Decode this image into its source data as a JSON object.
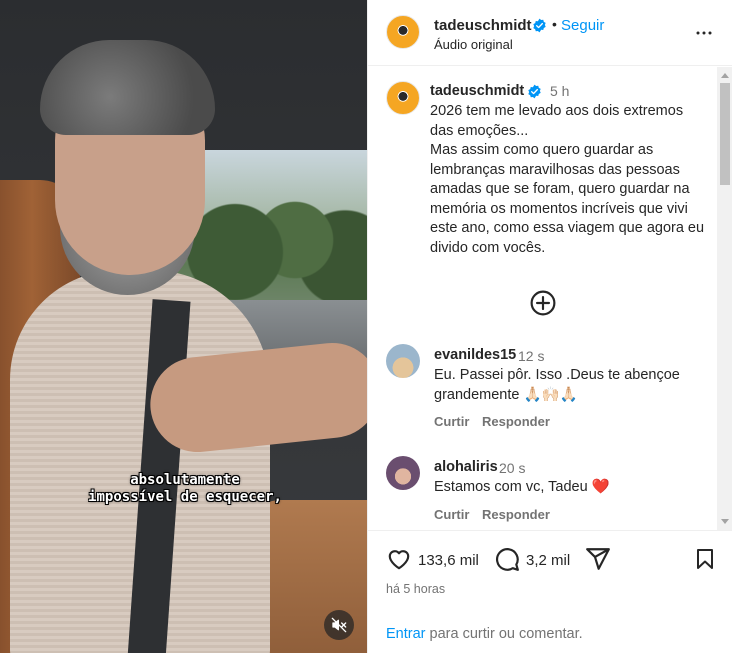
{
  "video": {
    "subtitle_line1": "absolutamente",
    "subtitle_line2": "impossível de esquecer,",
    "mute_icon": "speaker-muted-icon"
  },
  "header": {
    "username": "tadeuschmidt",
    "separator": "•",
    "follow_label": "Seguir",
    "audio_label": "Áudio original",
    "more_icon": "more-horizontal-icon"
  },
  "caption": {
    "username": "tadeuschmidt",
    "time": "5 h",
    "text": "2026 tem me levado aos dois extremos das emoções...\nMas assim como quero guardar as lembranças maravilhosas das pessoas amadas que se foram, quero guardar na memória os momentos incríveis que vivi este ano, como essa viagem que agora eu divido com vocês."
  },
  "load_more_icon": "plus-circle-icon",
  "comments": [
    {
      "username": "evanildes15",
      "time": "12 s",
      "text_line1": "Eu. Passei pôr. Isso .Deus te abençoe",
      "text_line2": "grandemente 🙏🏻🙌🏻🙏🏻",
      "like_label": "Curtir",
      "reply_label": "Responder"
    },
    {
      "username": "alohaliris",
      "time": "20 s",
      "text": "Estamos com vc, Tadeu ❤️",
      "like_label": "Curtir",
      "reply_label": "Responder"
    }
  ],
  "footer": {
    "likes": "133,6 mil",
    "comments": "3,2 mil",
    "posted": "há 5 horas",
    "login_link": "Entrar",
    "login_rest": " para curtir ou comentar."
  },
  "colors": {
    "link": "#0095f6",
    "verified": "#0095f6",
    "muted_text": "#737373",
    "text": "#262626"
  }
}
